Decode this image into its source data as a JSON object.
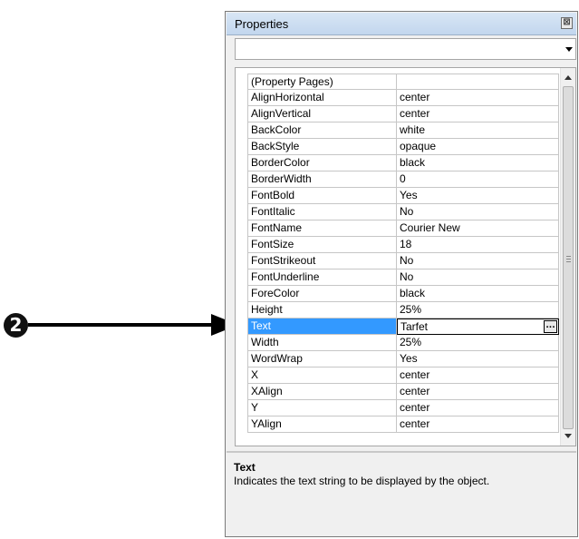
{
  "callout": {
    "number": "2"
  },
  "window": {
    "title": "Properties",
    "close_icon_glyph": "⊠",
    "object_selector": {
      "value": ""
    }
  },
  "grid": {
    "rows": [
      {
        "name": "(Property Pages)",
        "value": ""
      },
      {
        "name": "AlignHorizontal",
        "value": "center"
      },
      {
        "name": "AlignVertical",
        "value": "center"
      },
      {
        "name": "BackColor",
        "value": "white"
      },
      {
        "name": "BackStyle",
        "value": "opaque"
      },
      {
        "name": "BorderColor",
        "value": "black"
      },
      {
        "name": "BorderWidth",
        "value": "0"
      },
      {
        "name": "FontBold",
        "value": "Yes"
      },
      {
        "name": "FontItalic",
        "value": "No"
      },
      {
        "name": "FontName",
        "value": "Courier New"
      },
      {
        "name": "FontSize",
        "value": "18"
      },
      {
        "name": "FontStrikeout",
        "value": "No"
      },
      {
        "name": "FontUnderline",
        "value": "No"
      },
      {
        "name": "ForeColor",
        "value": "black"
      },
      {
        "name": "Height",
        "value": "25%"
      },
      {
        "name": "Text",
        "value": "Tarfet",
        "selected": true
      },
      {
        "name": "Width",
        "value": "25%"
      },
      {
        "name": "WordWrap",
        "value": "Yes"
      },
      {
        "name": "X",
        "value": "center"
      },
      {
        "name": "XAlign",
        "value": "center"
      },
      {
        "name": "Y",
        "value": "center"
      },
      {
        "name": "YAlign",
        "value": "center"
      }
    ],
    "ellipsis_label": "..."
  },
  "description": {
    "title": "Text",
    "text": "Indicates the text string to be displayed by the object."
  },
  "colors": {
    "selection": "#3399ff",
    "titlebar": "#c9dcf1"
  }
}
